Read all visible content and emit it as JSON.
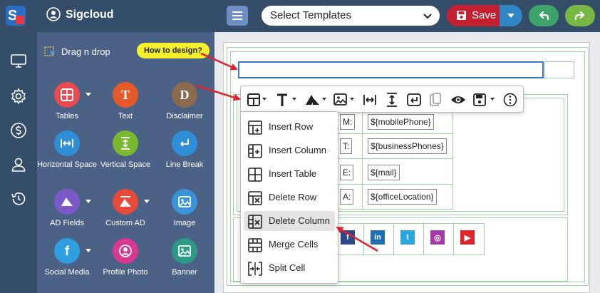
{
  "app": {
    "name": "Sigcloud"
  },
  "header": {
    "template_select": "Select Templates",
    "save_label": "Save"
  },
  "side_panel": {
    "title": "Drag n drop",
    "help_button": "How to design?",
    "tools": [
      {
        "label": "Tables",
        "color": "#e84a50"
      },
      {
        "label": "Text",
        "color": "#e55a2b"
      },
      {
        "label": "Disclaimer",
        "color": "#8b6a4e"
      },
      {
        "label": "Horizontal Space",
        "color": "#2f8fd6"
      },
      {
        "label": "Vertical Space",
        "color": "#7ab830"
      },
      {
        "label": "Line Break",
        "color": "#2f8fd6"
      },
      {
        "label": "AD Fields",
        "color": "#7b59c9"
      },
      {
        "label": "Custom AD",
        "color": "#e84a3a"
      },
      {
        "label": "Image",
        "color": "#3a93d8"
      },
      {
        "label": "Social Media",
        "color": "#2f9fe0"
      },
      {
        "label": "Profile Photo",
        "color": "#d8388f"
      },
      {
        "label": "Banner",
        "color": "#2e9a83"
      }
    ]
  },
  "signature": {
    "rows": [
      {
        "label": "M:",
        "value": "${mobilePhone}"
      },
      {
        "label": "T:",
        "value": "${businessPhones}"
      },
      {
        "label": "E:",
        "value": "${mail}"
      },
      {
        "label": "A:",
        "value": "${officeLocation}"
      }
    ],
    "social": [
      {
        "text": "f",
        "color": "#2b4a8b"
      },
      {
        "text": "in",
        "color": "#1f6fb0"
      },
      {
        "text": "t",
        "color": "#2aa6e0"
      },
      {
        "text": "◎",
        "color": "#a43aa6"
      },
      {
        "text": "▶",
        "color": "#e0242a"
      }
    ]
  },
  "table_menu": {
    "items": [
      {
        "label": "Insert Row",
        "icon": "insert-row-icon"
      },
      {
        "label": "Insert Column",
        "icon": "insert-column-icon"
      },
      {
        "label": "Insert Table",
        "icon": "insert-table-icon"
      },
      {
        "label": "Delete Row",
        "icon": "delete-row-icon"
      },
      {
        "label": "Delete Column",
        "icon": "delete-column-icon"
      },
      {
        "label": "Merge Cells",
        "icon": "merge-cells-icon"
      },
      {
        "label": "Split Cell",
        "icon": "split-cell-icon"
      }
    ],
    "active": "Delete Column"
  },
  "colors": {
    "topbar": "#344d68",
    "panel": "#4b6286",
    "save": "#c42030",
    "accent_arrow": "#e02030"
  }
}
